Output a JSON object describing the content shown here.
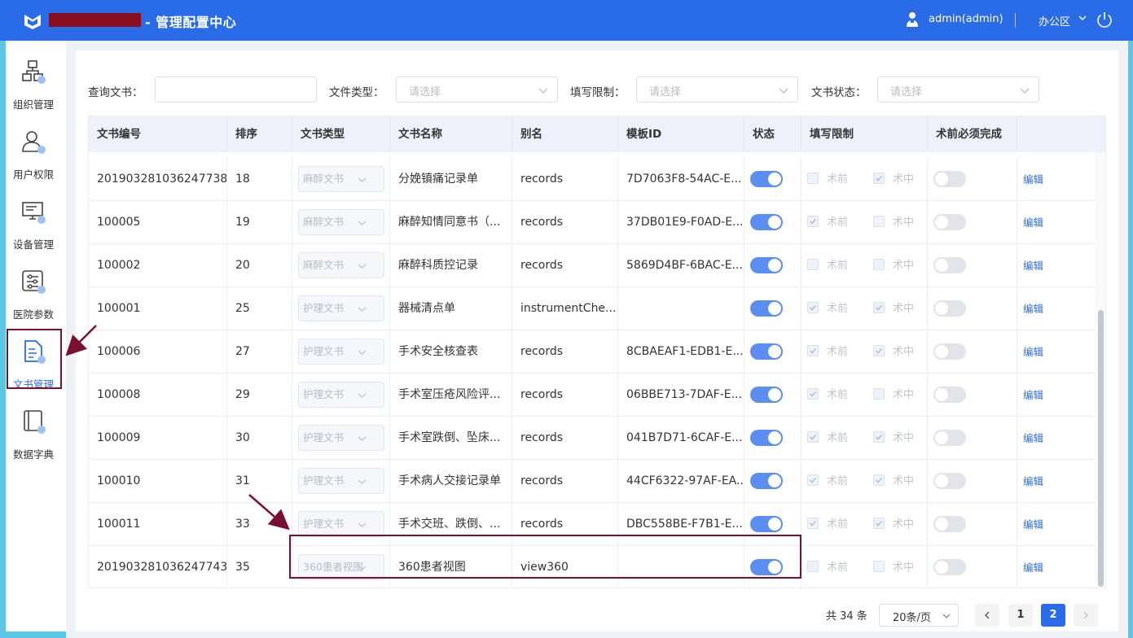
{
  "header": {
    "title": "- 管理配置中心",
    "user": "admin(admin)",
    "office": "办公区"
  },
  "sidebar": {
    "items": [
      {
        "label": "组织管理",
        "icon": "org-structure-icon"
      },
      {
        "label": "用户权限",
        "icon": "user-icon"
      },
      {
        "label": "设备管理",
        "icon": "monitor-icon"
      },
      {
        "label": "医院参数",
        "icon": "sliders-icon"
      },
      {
        "label": "文书管理",
        "icon": "document-icon",
        "active": true
      },
      {
        "label": "数据字典",
        "icon": "book-icon"
      }
    ]
  },
  "filters": {
    "doc_query": {
      "label": "查询文书：",
      "value": ""
    },
    "file_type": {
      "label": "文件类型：",
      "placeholder": "请选择"
    },
    "fill_limit": {
      "label": "填写限制：",
      "placeholder": "请选择"
    },
    "doc_status": {
      "label": "文书状态：",
      "placeholder": "请选择"
    }
  },
  "table": {
    "columns": [
      "文书编号",
      "排序",
      "文书类型",
      "文书名称",
      "别名",
      "模板ID",
      "状态",
      "填写限制",
      "术前必须完成"
    ],
    "fill_options": {
      "pre": "术前",
      "intra": "术中"
    },
    "edit_label": "编辑",
    "rows": [
      {
        "id": "201903281036247738",
        "order": "18",
        "type": "麻醉文书",
        "name": "分娩镇痛记录单",
        "alias": "records",
        "template": "7D7063F8-54AC-E...",
        "status": true,
        "pre": false,
        "intra": true,
        "required": false
      },
      {
        "id": "100005",
        "order": "19",
        "type": "麻醉文书",
        "name": "麻醉知情同意书（...",
        "alias": "records",
        "template": "37DB01E9-F0AD-E...",
        "status": true,
        "pre": true,
        "intra": false,
        "required": false
      },
      {
        "id": "100002",
        "order": "20",
        "type": "麻醉文书",
        "name": "麻醉科质控记录",
        "alias": "records",
        "template": "5869D4BF-6BAC-E...",
        "status": true,
        "pre": false,
        "intra": false,
        "required": false
      },
      {
        "id": "100001",
        "order": "25",
        "type": "护理文书",
        "name": "器械清点单",
        "alias": "instrumentChe...",
        "template": "",
        "status": true,
        "pre": true,
        "intra": true,
        "required": false
      },
      {
        "id": "100006",
        "order": "27",
        "type": "护理文书",
        "name": "手术安全核查表",
        "alias": "records",
        "template": "8CBAEAF1-EDB1-E...",
        "status": true,
        "pre": true,
        "intra": true,
        "required": false
      },
      {
        "id": "100008",
        "order": "29",
        "type": "护理文书",
        "name": "手术室压疮风险评...",
        "alias": "records",
        "template": "06BBE713-7DAF-E...",
        "status": true,
        "pre": true,
        "intra": false,
        "required": false
      },
      {
        "id": "100009",
        "order": "30",
        "type": "护理文书",
        "name": "手术室跌倒、坠床...",
        "alias": "records",
        "template": "041B7D71-6CAF-E...",
        "status": true,
        "pre": true,
        "intra": true,
        "required": false
      },
      {
        "id": "100010",
        "order": "31",
        "type": "护理文书",
        "name": "手术病人交接记录单",
        "alias": "records",
        "template": "44CF6322-97AF-EA...",
        "status": true,
        "pre": true,
        "intra": true,
        "required": false
      },
      {
        "id": "100011",
        "order": "33",
        "type": "护理文书",
        "name": "手术交班、跌倒、...",
        "alias": "records",
        "template": "DBC558BE-F7B1-E...",
        "status": true,
        "pre": true,
        "intra": true,
        "required": false
      },
      {
        "id": "201903281036247743",
        "order": "35",
        "type": "360患者视图",
        "name": "360患者视图",
        "alias": "view360",
        "template": "",
        "status": true,
        "pre": false,
        "intra": false,
        "required": false
      }
    ]
  },
  "pagination": {
    "total": "共 34 条",
    "page_size": "20条/页",
    "pages": [
      "1",
      "2"
    ],
    "current": "2"
  },
  "colors": {
    "primary": "#2a6ce8",
    "annotation": "#7a1030"
  }
}
